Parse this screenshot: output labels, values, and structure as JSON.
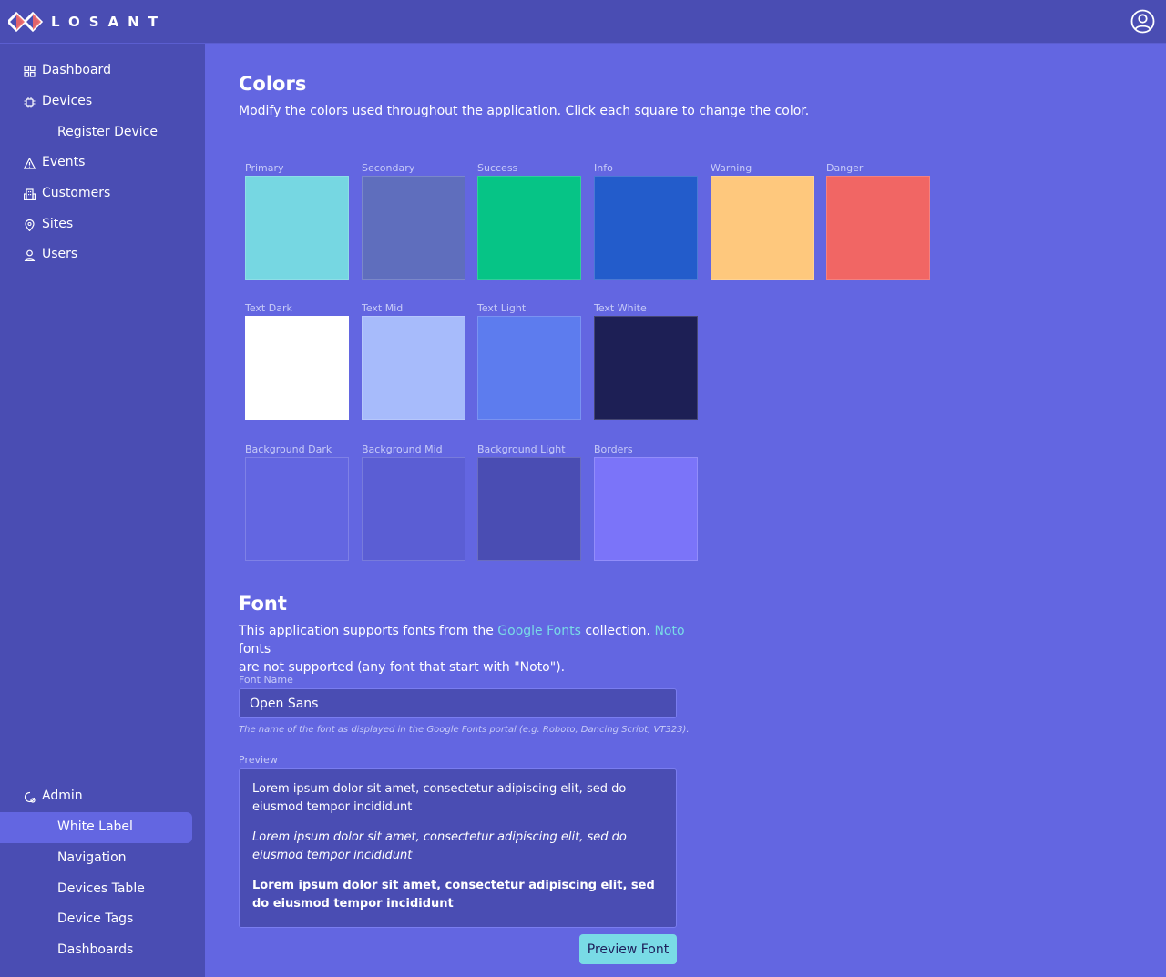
{
  "header": {
    "brand": "LOSANT",
    "profile_icon": "user-circle-icon"
  },
  "sidebar": {
    "items": [
      {
        "label": "Dashboard",
        "icon": "grid-icon"
      },
      {
        "label": "Devices",
        "icon": "chip-icon"
      },
      {
        "label": "Register Device"
      },
      {
        "label": "Events",
        "icon": "warning-icon"
      },
      {
        "label": "Customers",
        "icon": "building-icon"
      },
      {
        "label": "Sites",
        "icon": "map-pin-icon"
      },
      {
        "label": "Users",
        "icon": "user-icon"
      }
    ],
    "admin": {
      "label": "Admin",
      "icon": "admin-gear-icon",
      "items": [
        {
          "label": "White Label",
          "active": true
        },
        {
          "label": "Navigation"
        },
        {
          "label": "Devices Table"
        },
        {
          "label": "Device Tags"
        },
        {
          "label": "Dashboards"
        }
      ]
    }
  },
  "colors_section": {
    "title": "Colors",
    "description": "Modify the colors used throughout the application. Click each square to change the color.",
    "swatches": [
      {
        "label": "Primary",
        "color": "#76d7e2"
      },
      {
        "label": "Secondary",
        "color": "#5f6ebd"
      },
      {
        "label": "Success",
        "color": "#06c486"
      },
      {
        "label": "Info",
        "color": "#235ccb"
      },
      {
        "label": "Warning",
        "color": "#fec87d"
      },
      {
        "label": "Danger",
        "color": "#f16664"
      },
      {
        "label": "Text Dark",
        "color": "#ffffff"
      },
      {
        "label": "Text Mid",
        "color": "#a7bbfb"
      },
      {
        "label": "Text Light",
        "color": "#5d7cee"
      },
      {
        "label": "Text White",
        "color": "#1d1f55"
      },
      {
        "label": "Background Dark",
        "color": "#6366e1"
      },
      {
        "label": "Background Mid",
        "color": "#5b5ed4"
      },
      {
        "label": "Background Light",
        "color": "#4a4db3"
      },
      {
        "label": "Borders",
        "color": "#7b74f9"
      }
    ]
  },
  "font_section": {
    "title": "Font",
    "desc_part1": "This application supports fonts from the ",
    "link_google": "Google Fonts",
    "desc_part2": " collection. ",
    "link_noto": "Noto",
    "desc_part3": " fonts",
    "desc_line2": "are not supported (any font that start with \"Noto\").",
    "font_name_label": "Font Name",
    "font_name_value": "Open Sans",
    "font_hint": "The name of the font as displayed in the Google Fonts portal (e.g. Roboto, Dancing Script, VT323).",
    "preview_label": "Preview",
    "preview_regular": "Lorem ipsum dolor sit amet, consectetur adipiscing elit, sed do eiusmod tempor incididunt",
    "preview_italic": "Lorem ipsum dolor sit amet, consectetur adipiscing elit, sed do eiusmod tempor incididunt",
    "preview_bold": "Lorem ipsum dolor sit amet, consectetur adipiscing elit, sed do eiusmod tempor incididunt",
    "preview_button": "Preview Font"
  }
}
